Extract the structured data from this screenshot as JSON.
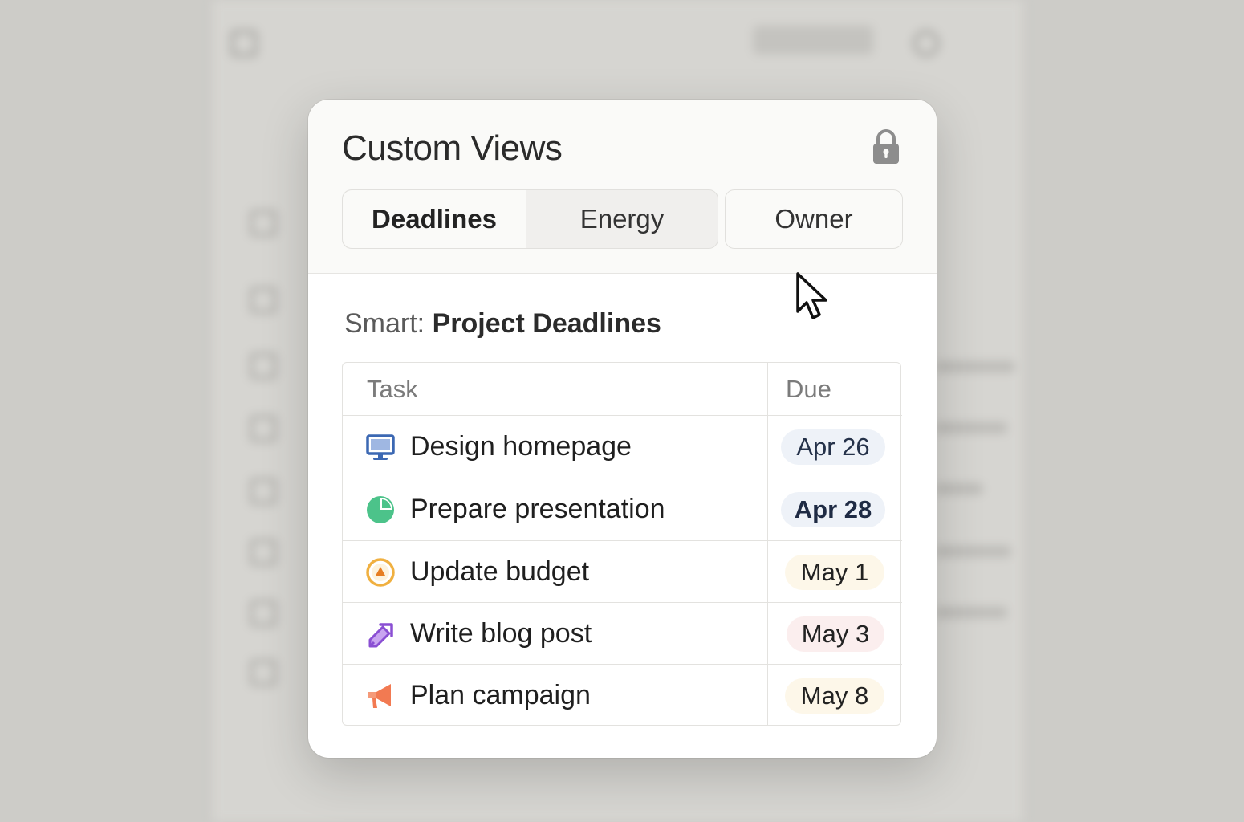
{
  "modal": {
    "title": "Custom Views",
    "tabs": [
      {
        "label": "Deadlines",
        "active": true
      },
      {
        "label": "Energy",
        "active": false
      },
      {
        "label": "Owner",
        "active": false
      }
    ],
    "smart_prefix": "Smart:",
    "smart_name": "Project Deadlines",
    "table": {
      "headers": {
        "task": "Task",
        "due": "Due"
      },
      "rows": [
        {
          "icon": "monitor-icon",
          "task": "Design homepage",
          "due": "Apr 26",
          "due_color": "#eef2f8",
          "bold": false
        },
        {
          "icon": "pie-chart-icon",
          "task": "Prepare presentation",
          "due": "Apr 28",
          "due_color": "#eef2f8",
          "bold": true
        },
        {
          "icon": "budget-circle-icon",
          "task": "Update budget",
          "due": "May 1",
          "due_color": "#fdf7e9",
          "bold": false
        },
        {
          "icon": "pen-arrow-icon",
          "task": "Write blog post",
          "due": "May 3",
          "due_color": "#fbeeee",
          "bold": false
        },
        {
          "icon": "megaphone-icon",
          "task": "Plan campaign",
          "due": "May 8",
          "due_color": "#fdf7e9",
          "bold": false
        }
      ]
    }
  },
  "colors": {
    "monitor": "#3c68b3",
    "pie": "#4cc38a",
    "budget": "#f0b040",
    "pen": "#8a4fd3",
    "megaphone": "#f27a52"
  }
}
